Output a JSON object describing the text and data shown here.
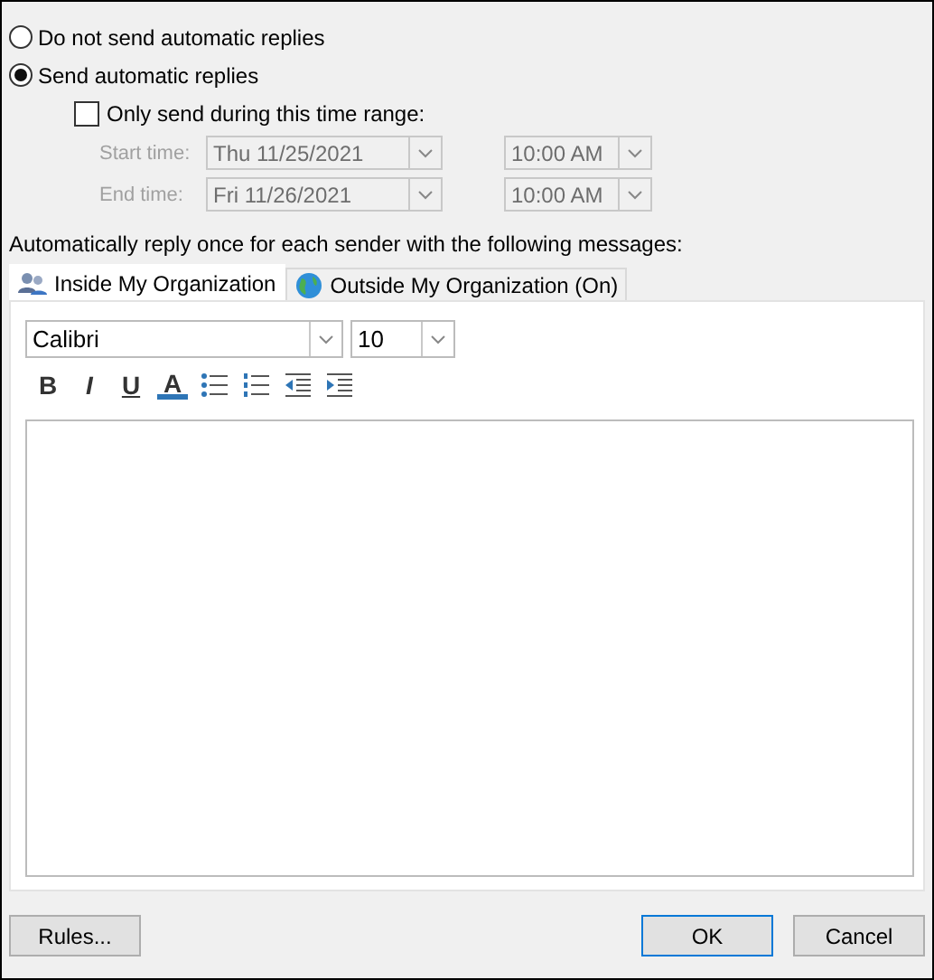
{
  "reply_options": [
    {
      "label": "Do not send automatic replies",
      "selected": false
    },
    {
      "label": "Send automatic replies",
      "selected": true
    }
  ],
  "time_range": {
    "label": "Only send during this time range:",
    "checked": false,
    "disabled": true,
    "rows": [
      {
        "label": "Start time:",
        "date": "Thu 11/25/2021",
        "time": "10:00 AM"
      },
      {
        "label": "End time:",
        "date": "Fri 11/26/2021",
        "time": "10:00 AM"
      }
    ]
  },
  "message_label": "Automatically reply once for each sender with the following messages:",
  "tabs": [
    {
      "label": "Inside My Organization",
      "kind": "people",
      "selected": true
    },
    {
      "label": "Outside My Organization (On)",
      "kind": "globe",
      "selected": false
    }
  ],
  "font": {
    "name": "Calibri",
    "size": "10"
  },
  "toolbar": [
    {
      "kind": "bold",
      "text": "B"
    },
    {
      "kind": "italic",
      "text": "I"
    },
    {
      "kind": "underline",
      "text": "U"
    },
    {
      "kind": "font_color",
      "text": "A"
    },
    {
      "kind": "bullets"
    },
    {
      "kind": "numbering"
    },
    {
      "kind": "outdent"
    },
    {
      "kind": "indent"
    }
  ],
  "buttons": [
    {
      "label": "Rules...",
      "kind": "left"
    },
    {
      "label": "OK",
      "kind": "default"
    },
    {
      "label": "Cancel",
      "kind": "right"
    }
  ]
}
